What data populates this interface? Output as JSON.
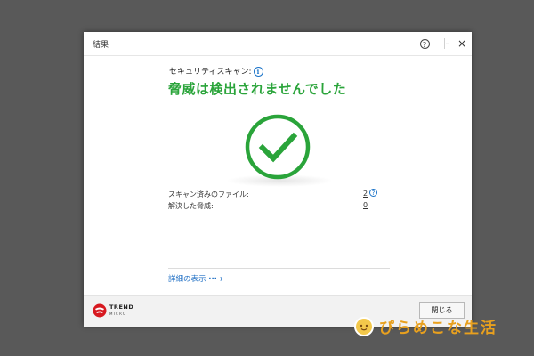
{
  "window": {
    "title": "結果",
    "help_symbol": "?",
    "minimize_symbol": "–",
    "close_symbol": "×"
  },
  "scan": {
    "label": "セキュリティスキャン:",
    "info_symbol": "i",
    "headline": "脅威は検出されませんでした",
    "status_icon": "checkmark-circle-icon",
    "status_color": "#2aa43a"
  },
  "results": [
    {
      "label": "スキャン済みのファイル:",
      "value": "2",
      "help": "?"
    },
    {
      "label": "解決した脅威:",
      "value": "0"
    }
  ],
  "details_link": {
    "label": "詳細の表示",
    "arrow": "···➔"
  },
  "footer": {
    "brand_line1": "TREND",
    "brand_line2": "MICRO",
    "close_button": "閉じる"
  },
  "watermark": {
    "text": "ぴらめこな生活"
  },
  "colors": {
    "accent_green": "#2aa43a",
    "link_blue": "#1f6fc4",
    "brand_red": "#d71920"
  }
}
